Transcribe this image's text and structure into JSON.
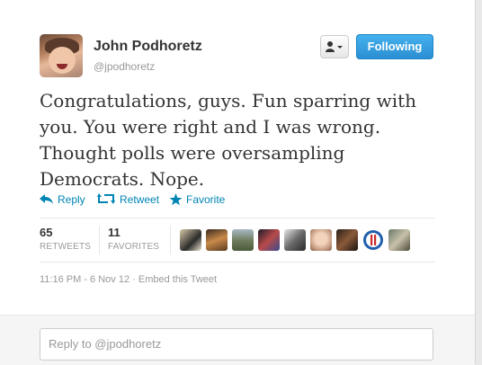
{
  "tweet": {
    "author_name": "John Podhoretz",
    "author_handle": "@jpodhoretz",
    "text": "Congratulations, guys. Fun sparring with you. You were right and I was wrong. Thought polls were oversampling Democrats. Nope.",
    "timestamp": "11:16 PM - 6 Nov 12",
    "separator": " · ",
    "embed_label": "Embed this Tweet"
  },
  "header": {
    "follow_button_label": "Following",
    "user_actions_icon": "person-with-dropdown-icon"
  },
  "actions": {
    "reply_label": "Reply",
    "retweet_label": "Retweet",
    "favorite_label": "Favorite"
  },
  "stats": {
    "retweets_count": "65",
    "retweets_label": "RETWEETS",
    "favorites_count": "11",
    "favorites_label": "FAVORITES"
  },
  "favoriters_avatar_count": 9,
  "reply": {
    "placeholder": "Reply to @jpodhoretz"
  },
  "colors": {
    "link_blue": "#0084b4",
    "follow_button": "#2a8fd3",
    "text": "#333333",
    "muted": "#999999"
  }
}
